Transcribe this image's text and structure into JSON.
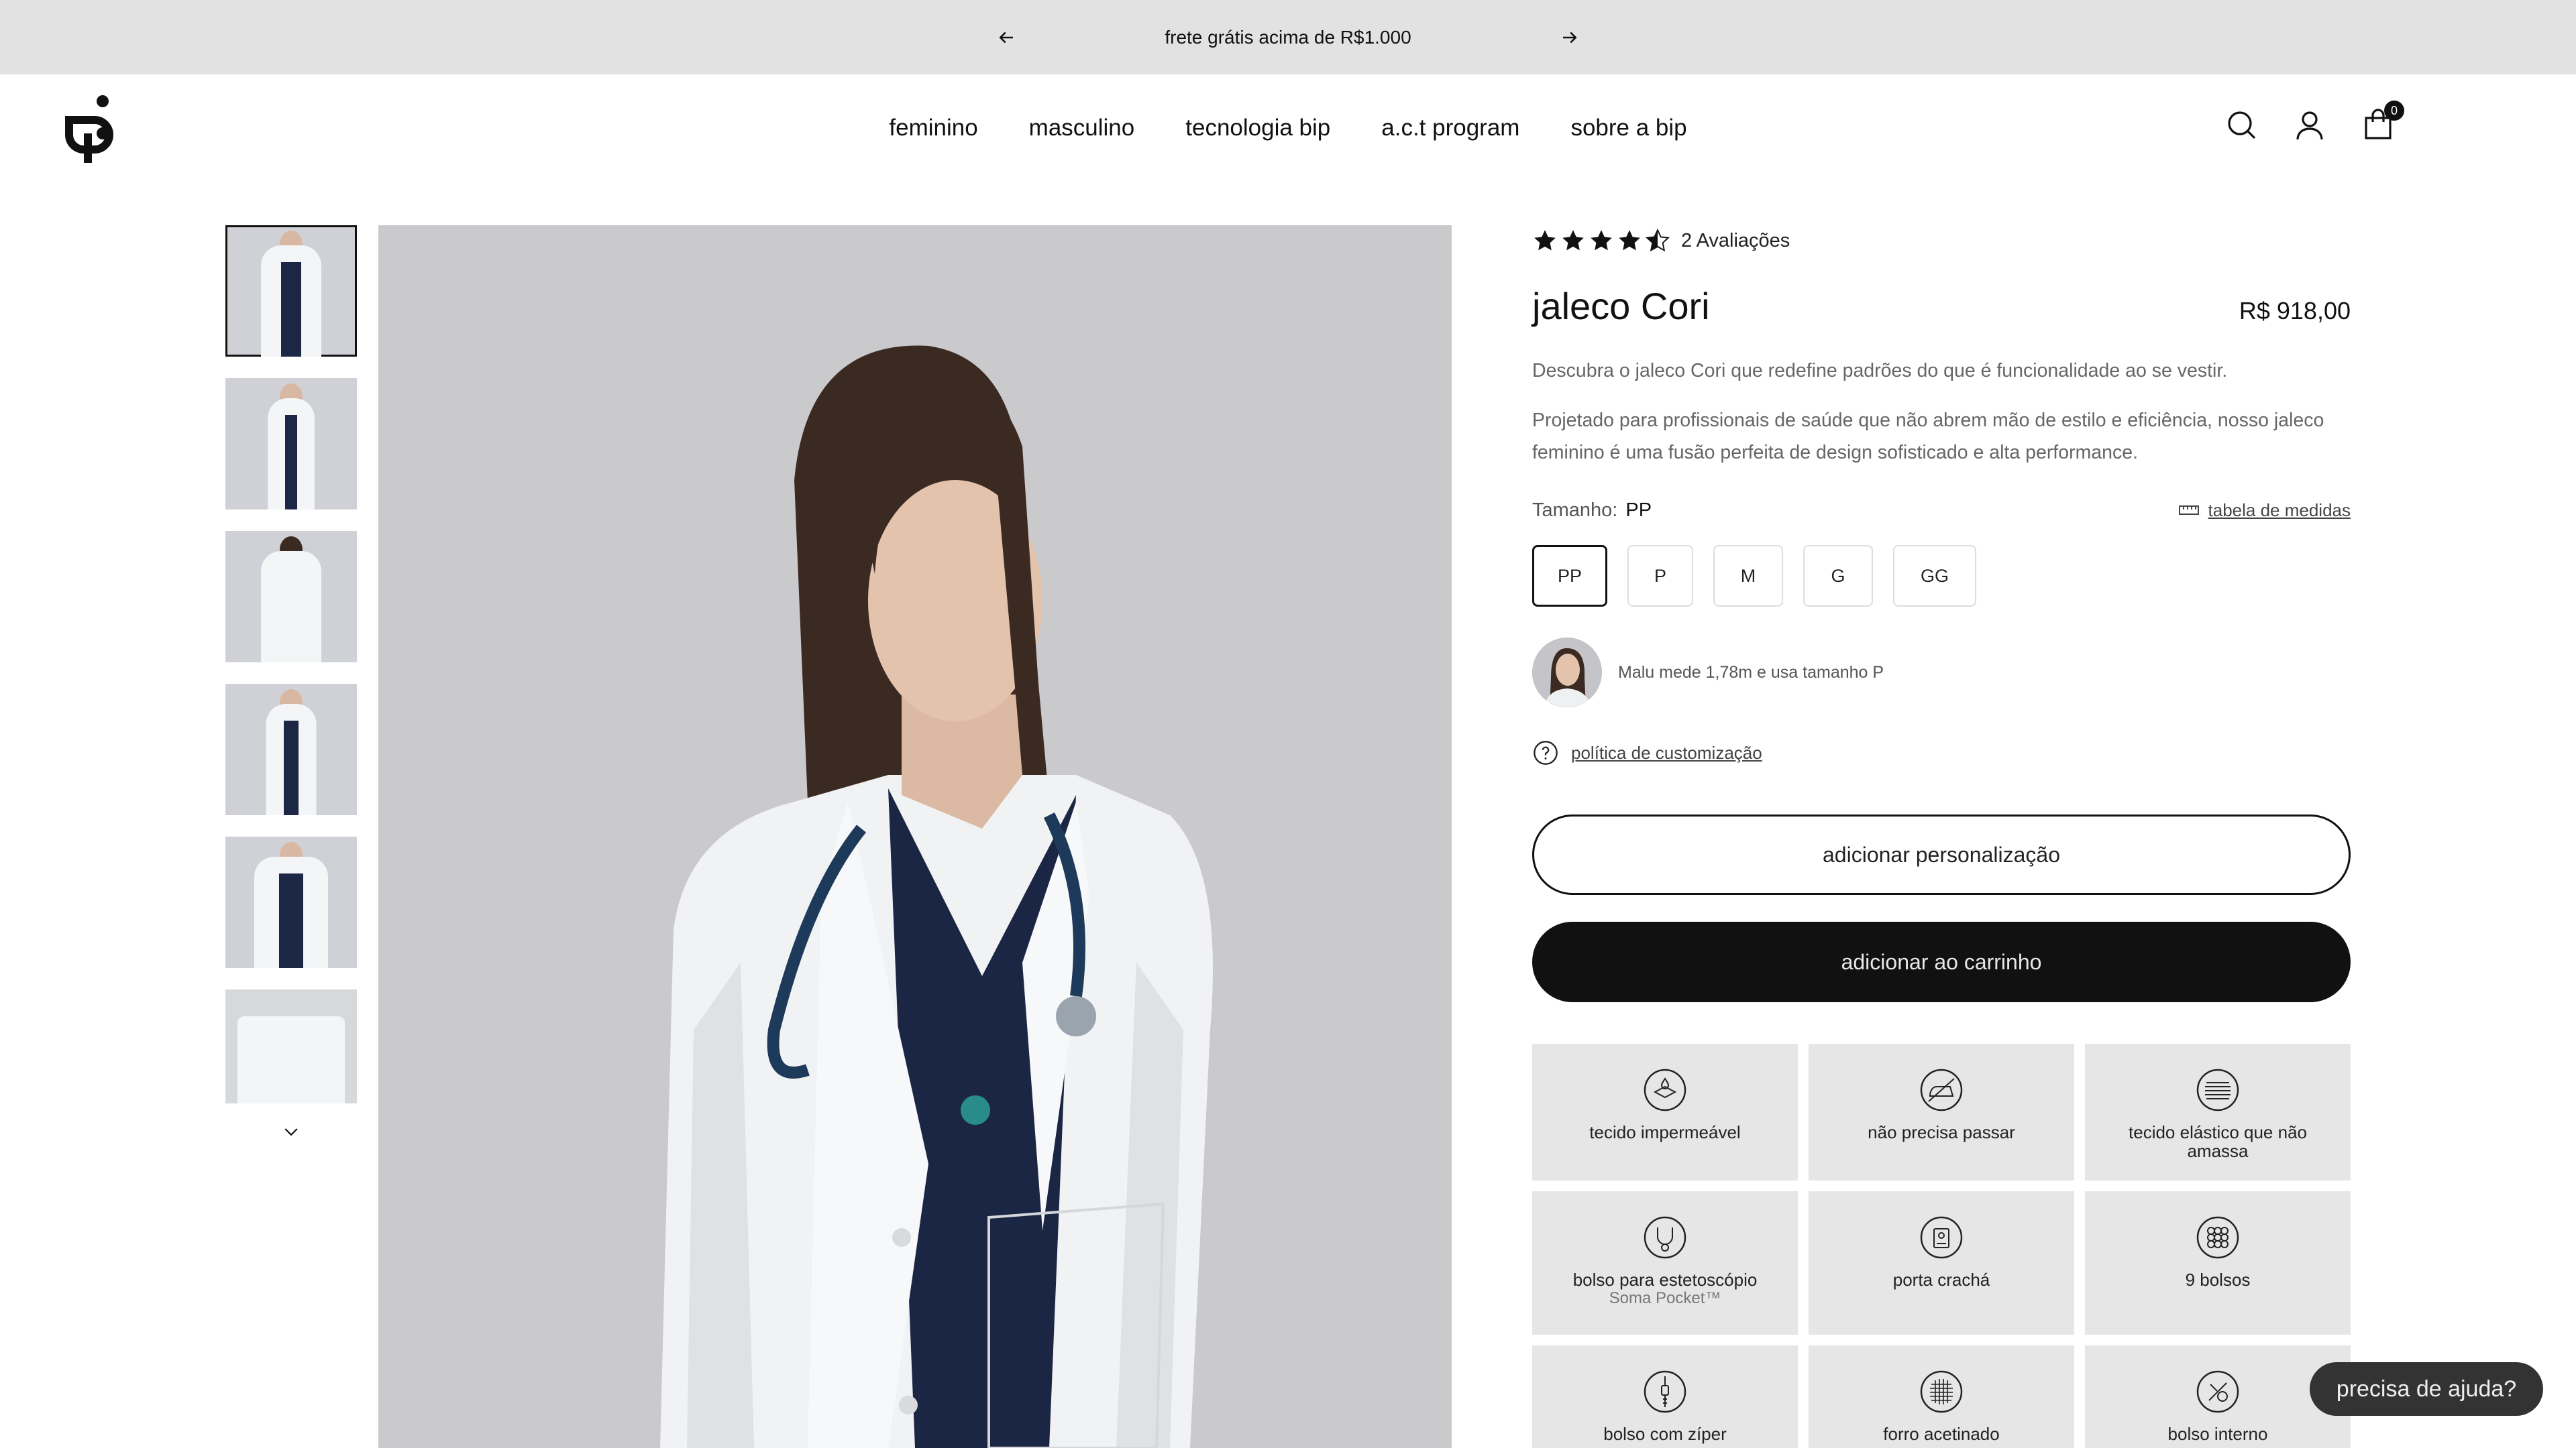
{
  "announcement": {
    "message": "frete grátis acima de R$1.000",
    "prev_icon": "arrow-left-icon",
    "next_icon": "arrow-right-icon"
  },
  "header": {
    "logo_icon": "bip-logo-icon",
    "nav": [
      "feminino",
      "masculino",
      "tecnologia bip",
      "a.c.t program",
      "sobre a bip"
    ],
    "icons": [
      "search-icon",
      "user-icon",
      "cart-icon"
    ],
    "cart_count": "0"
  },
  "gallery": {
    "thumbnail_count": 6,
    "active_thumbnail": 1,
    "scroll_icon": "chevron-down-icon"
  },
  "product": {
    "rating": 4.5,
    "reviews": "2 Avaliações",
    "title": "jaleco Cori",
    "price": "R$ 918,00",
    "description": [
      "Descubra o jaleco Cori que redefine padrões do que é funcionalidade ao se vestir.",
      "Projetado para profissionais de saúde que não abrem mão de estilo e eficiência, nosso jaleco feminino é uma fusão perfeita de design sofisticado e alta performance."
    ],
    "size_label": "Tamanho:",
    "selected_size": "PP",
    "size_chart_label": "tabela de medidas",
    "sizes": [
      "PP",
      "P",
      "M",
      "G",
      "GG"
    ],
    "model_note": "Malu mede 1,78m e usa tamanho P",
    "policy_label": "política de customização",
    "customize_button": "adicionar personalização",
    "add_to_cart_button": "adicionar ao carrinho"
  },
  "features": [
    {
      "label": "tecido impermeável",
      "sub": "",
      "icon": "waterproof-fabric-icon"
    },
    {
      "label": "não precisa passar",
      "sub": "",
      "icon": "no-iron-icon"
    },
    {
      "label": "tecido elástico que não amassa",
      "sub": "",
      "icon": "stretch-fabric-icon"
    },
    {
      "label": "bolso para estetoscópio",
      "sub": "Soma Pocket™",
      "icon": "stethoscope-pocket-icon"
    },
    {
      "label": "porta crachá",
      "sub": "",
      "icon": "badge-holder-icon"
    },
    {
      "label": "9 bolsos",
      "sub": "",
      "icon": "pockets-icon"
    },
    {
      "label": "bolso com zíper",
      "sub": "",
      "icon": "zipper-pocket-icon"
    },
    {
      "label": "forro acetinado",
      "sub": "",
      "icon": "satin-lining-icon"
    },
    {
      "label": "bolso interno",
      "sub": "",
      "icon": "inner-pocket-icon"
    }
  ],
  "help_button": "precisa de ajuda?"
}
